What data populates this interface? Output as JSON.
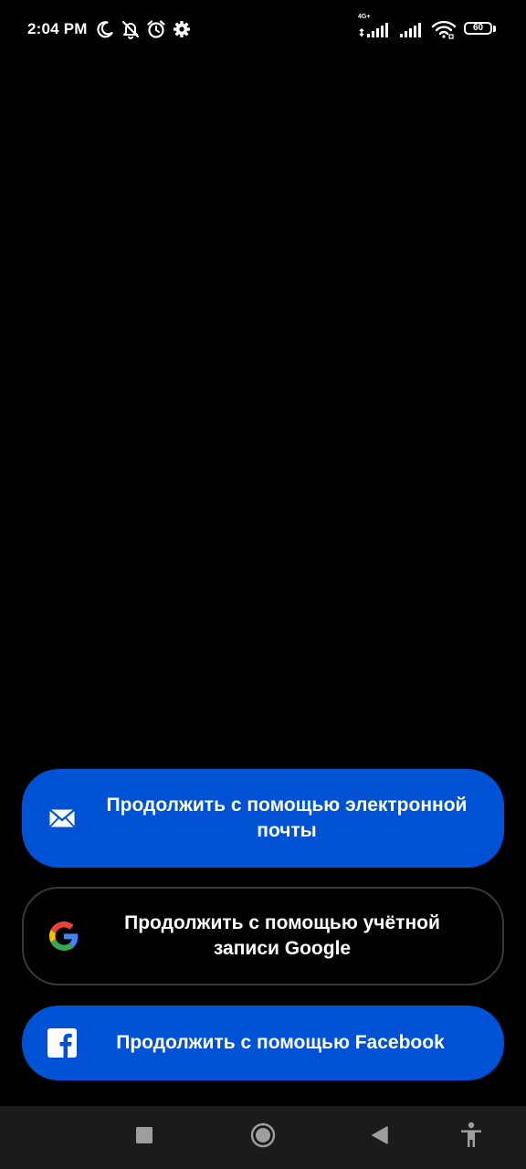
{
  "status_bar": {
    "time": "2:04 PM",
    "network_label": "4G+",
    "battery_level": "60",
    "left_icons": [
      "moon-icon",
      "silent-icon",
      "alarm-icon",
      "settings-icon"
    ],
    "right_icons": [
      "signal-4g-icon",
      "signal-icon",
      "wifi-icon",
      "battery-icon"
    ]
  },
  "auth": {
    "email_button_label": "Продолжить с помощью электронной почты",
    "google_button_label": "Продолжить с помощью учётной записи Google",
    "facebook_button_label": "Продолжить с помощью Facebook"
  },
  "nav_bar": {
    "buttons": [
      "recents-icon",
      "home-icon",
      "back-icon",
      "accessibility-icon"
    ]
  },
  "colors": {
    "background": "#000000",
    "primary_button": "#0052d4",
    "outline": "#3a3a3a",
    "nav_bar": "#1b1b1b",
    "google_blue": "#4285F4",
    "google_red": "#EA4335",
    "google_yellow": "#FBBC05",
    "google_green": "#34A853"
  }
}
